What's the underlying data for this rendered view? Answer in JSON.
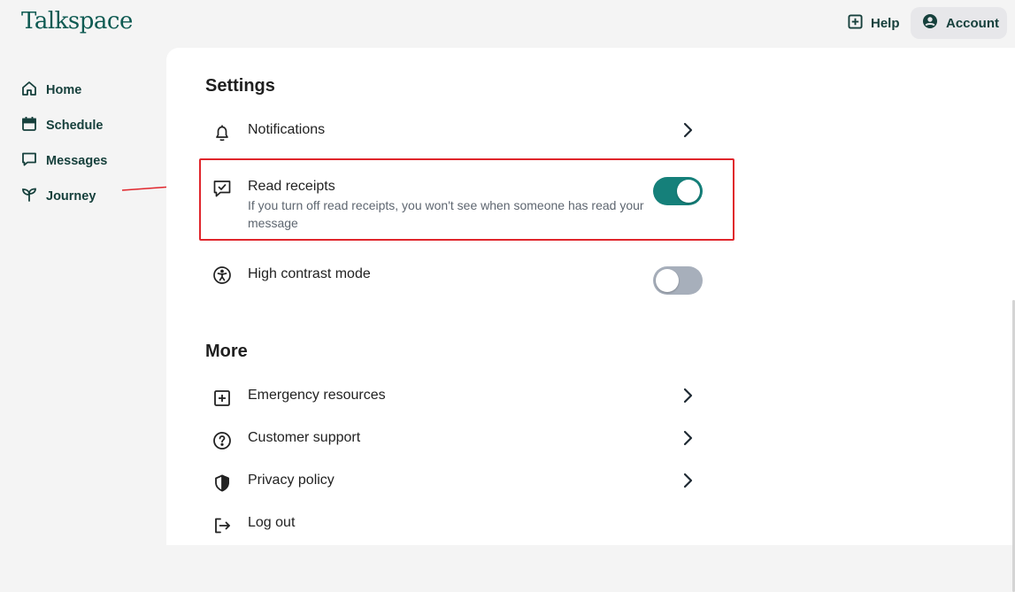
{
  "header": {
    "logo": "Talkspace",
    "help_label": "Help",
    "account_label": "Account"
  },
  "sidebar": {
    "items": [
      {
        "label": "Home",
        "icon": "home-icon"
      },
      {
        "label": "Schedule",
        "icon": "calendar-icon"
      },
      {
        "label": "Messages",
        "icon": "message-icon"
      },
      {
        "label": "Journey",
        "icon": "sprout-icon"
      }
    ]
  },
  "settings": {
    "title": "Settings",
    "notifications": {
      "label": "Notifications",
      "icon": "bell-icon"
    },
    "read_receipts": {
      "label": "Read receipts",
      "description": "If you turn off read receipts, you won't see when someone has read your message",
      "icon": "message-check-icon",
      "enabled": true
    },
    "high_contrast": {
      "label": "High contrast mode",
      "icon": "accessibility-icon",
      "enabled": false
    }
  },
  "more": {
    "title": "More",
    "items": [
      {
        "label": "Emergency resources",
        "icon": "plus-square-icon"
      },
      {
        "label": "Customer support",
        "icon": "question-circle-icon"
      },
      {
        "label": "Privacy policy",
        "icon": "shield-icon"
      },
      {
        "label": "Log out",
        "icon": "logout-icon"
      }
    ]
  },
  "colors": {
    "brand": "#0e5a52",
    "toggle_on": "#15807a",
    "toggle_off": "#a7afbb",
    "annotation": "#e0262c"
  }
}
